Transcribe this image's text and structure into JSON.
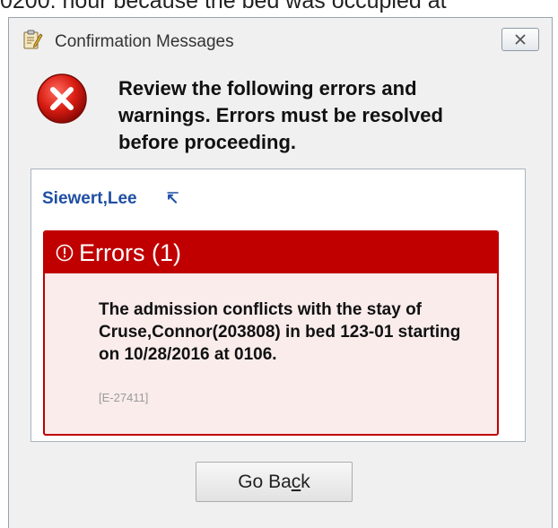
{
  "background": {
    "partial_text": "0200. hour because the bed was occupied at"
  },
  "window": {
    "title": "Confirmation Messages",
    "close_symbol": "close-icon",
    "header_message": "Review the following errors and warnings. Errors must be resolved before proceeding."
  },
  "patient": {
    "name": "Siewert,Lee",
    "link_icon": "external-link-arrow-icon",
    "link_glyph": "↸"
  },
  "errors": {
    "header": "Errors (1)",
    "items": [
      {
        "message": "The admission conflicts with the stay of Cruse,Connor(203808) in bed 123-01 starting on 10/28/2016 at 0106.",
        "code": "[E-27411]"
      }
    ]
  },
  "buttons": {
    "go_back_prefix": "Go Ba",
    "go_back_accel": "c",
    "go_back_suffix": "k"
  },
  "colors": {
    "error_red": "#c00000",
    "error_panel_bg": "#f9eceb",
    "patient_link": "#1f4fa3",
    "window_bg": "#f0f0f0"
  }
}
